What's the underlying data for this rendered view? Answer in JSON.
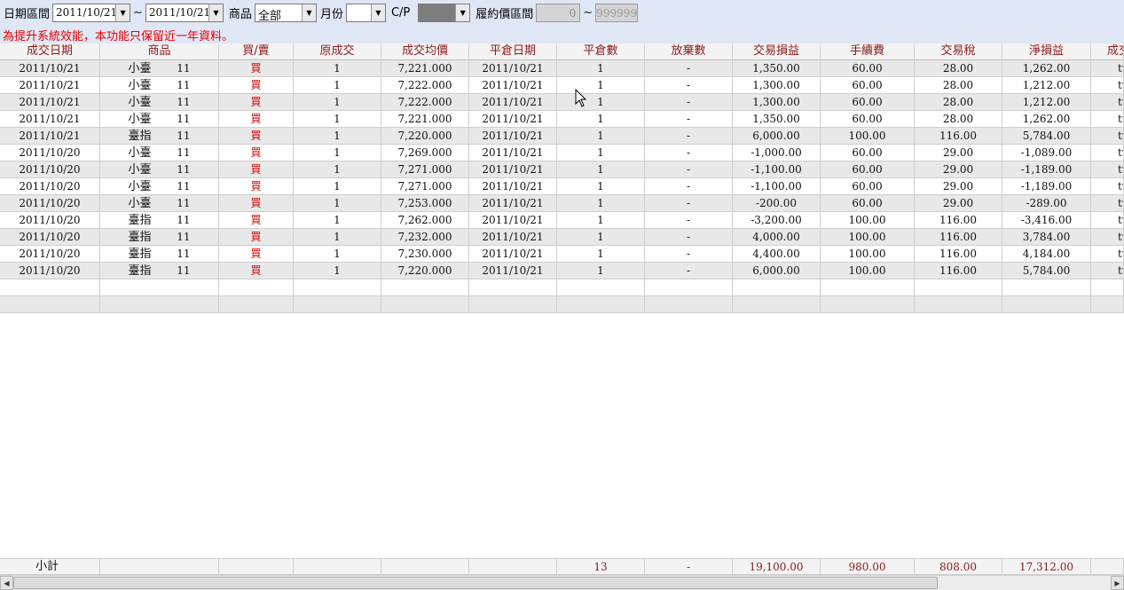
{
  "filters": {
    "date_range_label": "日期區間",
    "date_from": "2011/10/21",
    "tilde": "~",
    "date_to": "2011/10/21",
    "product_label": "商品",
    "product_value": "全部",
    "month_label": "月份",
    "month_value": "",
    "cp_label": "C/P",
    "cp_value": "",
    "strike_range_label": "履約價區間",
    "strike_from": "0",
    "strike_to": "999999"
  },
  "notice": "為提升系統效能，本功能只保留近一年資料。",
  "table": {
    "columns": [
      "成交日期",
      "商品",
      "買/賣",
      "原成交",
      "成交均價",
      "平倉日期",
      "平倉數",
      "放棄數",
      "交易損益",
      "手續費",
      "交易稅",
      "淨損益",
      "成交"
    ],
    "rows": [
      {
        "date": "2011/10/21",
        "product": "小臺",
        "month": "11",
        "side": "買",
        "orig": "1",
        "avg": "7,221.000",
        "close_date": "2011/10/21",
        "close_qty": "1",
        "abandon": "-",
        "pnl": "1,350.00",
        "fee": "60.00",
        "tax": "28.00",
        "net": "1,262.00",
        "extra": "tv"
      },
      {
        "date": "2011/10/21",
        "product": "小臺",
        "month": "11",
        "side": "買",
        "orig": "1",
        "avg": "7,222.000",
        "close_date": "2011/10/21",
        "close_qty": "1",
        "abandon": "-",
        "pnl": "1,300.00",
        "fee": "60.00",
        "tax": "28.00",
        "net": "1,212.00",
        "extra": "tv"
      },
      {
        "date": "2011/10/21",
        "product": "小臺",
        "month": "11",
        "side": "買",
        "orig": "1",
        "avg": "7,222.000",
        "close_date": "2011/10/21",
        "close_qty": "1",
        "abandon": "-",
        "pnl": "1,300.00",
        "fee": "60.00",
        "tax": "28.00",
        "net": "1,212.00",
        "extra": "tv"
      },
      {
        "date": "2011/10/21",
        "product": "小臺",
        "month": "11",
        "side": "買",
        "orig": "1",
        "avg": "7,221.000",
        "close_date": "2011/10/21",
        "close_qty": "1",
        "abandon": "-",
        "pnl": "1,350.00",
        "fee": "60.00",
        "tax": "28.00",
        "net": "1,262.00",
        "extra": "tv"
      },
      {
        "date": "2011/10/21",
        "product": "臺指",
        "month": "11",
        "side": "買",
        "orig": "1",
        "avg": "7,220.000",
        "close_date": "2011/10/21",
        "close_qty": "1",
        "abandon": "-",
        "pnl": "6,000.00",
        "fee": "100.00",
        "tax": "116.00",
        "net": "5,784.00",
        "extra": "tv"
      },
      {
        "date": "2011/10/20",
        "product": "小臺",
        "month": "11",
        "side": "買",
        "orig": "1",
        "avg": "7,269.000",
        "close_date": "2011/10/21",
        "close_qty": "1",
        "abandon": "-",
        "pnl": "-1,000.00",
        "fee": "60.00",
        "tax": "29.00",
        "net": "-1,089.00",
        "extra": "tv"
      },
      {
        "date": "2011/10/20",
        "product": "小臺",
        "month": "11",
        "side": "買",
        "orig": "1",
        "avg": "7,271.000",
        "close_date": "2011/10/21",
        "close_qty": "1",
        "abandon": "-",
        "pnl": "-1,100.00",
        "fee": "60.00",
        "tax": "29.00",
        "net": "-1,189.00",
        "extra": "tv"
      },
      {
        "date": "2011/10/20",
        "product": "小臺",
        "month": "11",
        "side": "買",
        "orig": "1",
        "avg": "7,271.000",
        "close_date": "2011/10/21",
        "close_qty": "1",
        "abandon": "-",
        "pnl": "-1,100.00",
        "fee": "60.00",
        "tax": "29.00",
        "net": "-1,189.00",
        "extra": "tv"
      },
      {
        "date": "2011/10/20",
        "product": "小臺",
        "month": "11",
        "side": "買",
        "orig": "1",
        "avg": "7,253.000",
        "close_date": "2011/10/21",
        "close_qty": "1",
        "abandon": "-",
        "pnl": "-200.00",
        "fee": "60.00",
        "tax": "29.00",
        "net": "-289.00",
        "extra": "tv"
      },
      {
        "date": "2011/10/20",
        "product": "臺指",
        "month": "11",
        "side": "買",
        "orig": "1",
        "avg": "7,262.000",
        "close_date": "2011/10/21",
        "close_qty": "1",
        "abandon": "-",
        "pnl": "-3,200.00",
        "fee": "100.00",
        "tax": "116.00",
        "net": "-3,416.00",
        "extra": "tv"
      },
      {
        "date": "2011/10/20",
        "product": "臺指",
        "month": "11",
        "side": "買",
        "orig": "1",
        "avg": "7,232.000",
        "close_date": "2011/10/21",
        "close_qty": "1",
        "abandon": "-",
        "pnl": "4,000.00",
        "fee": "100.00",
        "tax": "116.00",
        "net": "3,784.00",
        "extra": "tv"
      },
      {
        "date": "2011/10/20",
        "product": "臺指",
        "month": "11",
        "side": "買",
        "orig": "1",
        "avg": "7,230.000",
        "close_date": "2011/10/21",
        "close_qty": "1",
        "abandon": "-",
        "pnl": "4,400.00",
        "fee": "100.00",
        "tax": "116.00",
        "net": "4,184.00",
        "extra": "tv"
      },
      {
        "date": "2011/10/20",
        "product": "臺指",
        "month": "11",
        "side": "買",
        "orig": "1",
        "avg": "7,220.000",
        "close_date": "2011/10/21",
        "close_qty": "1",
        "abandon": "-",
        "pnl": "6,000.00",
        "fee": "100.00",
        "tax": "116.00",
        "net": "5,784.00",
        "extra": "tv"
      }
    ],
    "subtotal": {
      "label": "小計",
      "close_qty": "13",
      "abandon": "-",
      "pnl": "19,100.00",
      "fee": "980.00",
      "tax": "808.00",
      "net": "17,312.00"
    }
  },
  "colors": {
    "toolbar_bg": "#dfe7f6",
    "notice_text": "#e00000",
    "header_text": "#8b1a1a",
    "buy_text": "#d40000",
    "alt_row": "#e8e8e8"
  },
  "icons": [
    "dropdown-arrow-icon",
    "mouse-cursor-icon",
    "scroll-left-arrow-icon",
    "scroll-right-arrow-icon"
  ]
}
